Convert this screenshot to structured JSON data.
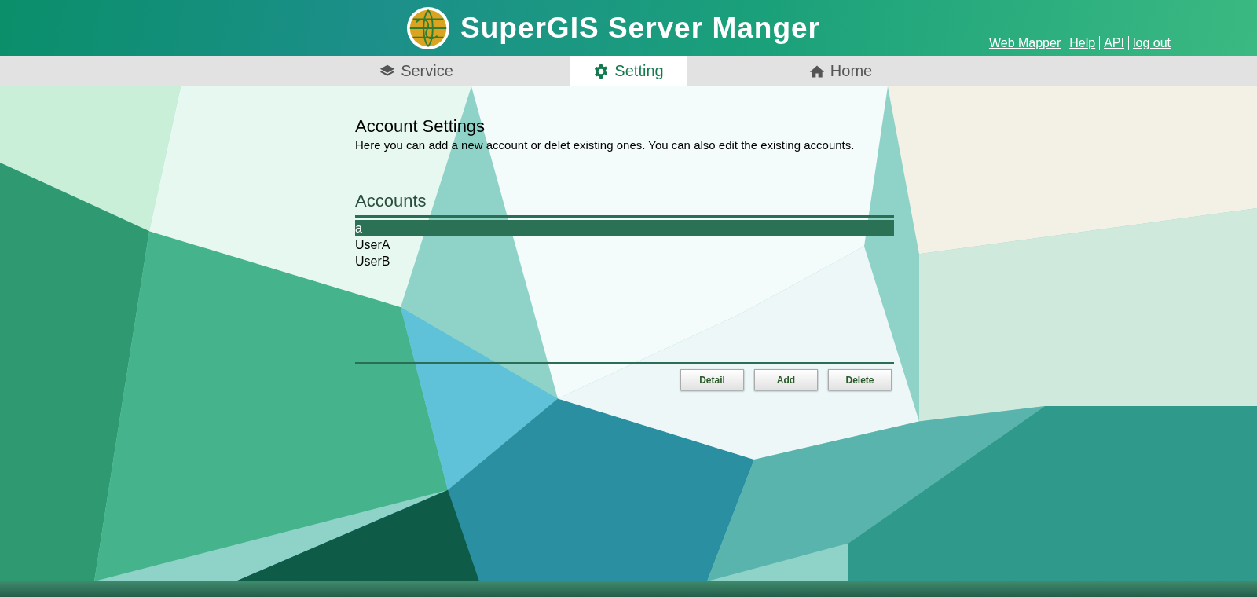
{
  "header": {
    "title": "SuperGIS Server Manger",
    "links": [
      "Web Mapper",
      "Help",
      "API",
      "log out"
    ]
  },
  "tabs": [
    {
      "label": "Service",
      "selected": false
    },
    {
      "label": "Setting",
      "selected": true
    },
    {
      "label": "Home",
      "selected": false
    }
  ],
  "page": {
    "title": "Account Settings",
    "description": "Here you can add a new account or delet existing ones. You can also edit the existing accounts."
  },
  "accounts": {
    "title": "Accounts",
    "items": [
      {
        "name": "a",
        "selected": true
      },
      {
        "name": "UserA",
        "selected": false
      },
      {
        "name": "UserB",
        "selected": false
      }
    ]
  },
  "buttons": [
    "Detail",
    "Add",
    "Delete"
  ]
}
